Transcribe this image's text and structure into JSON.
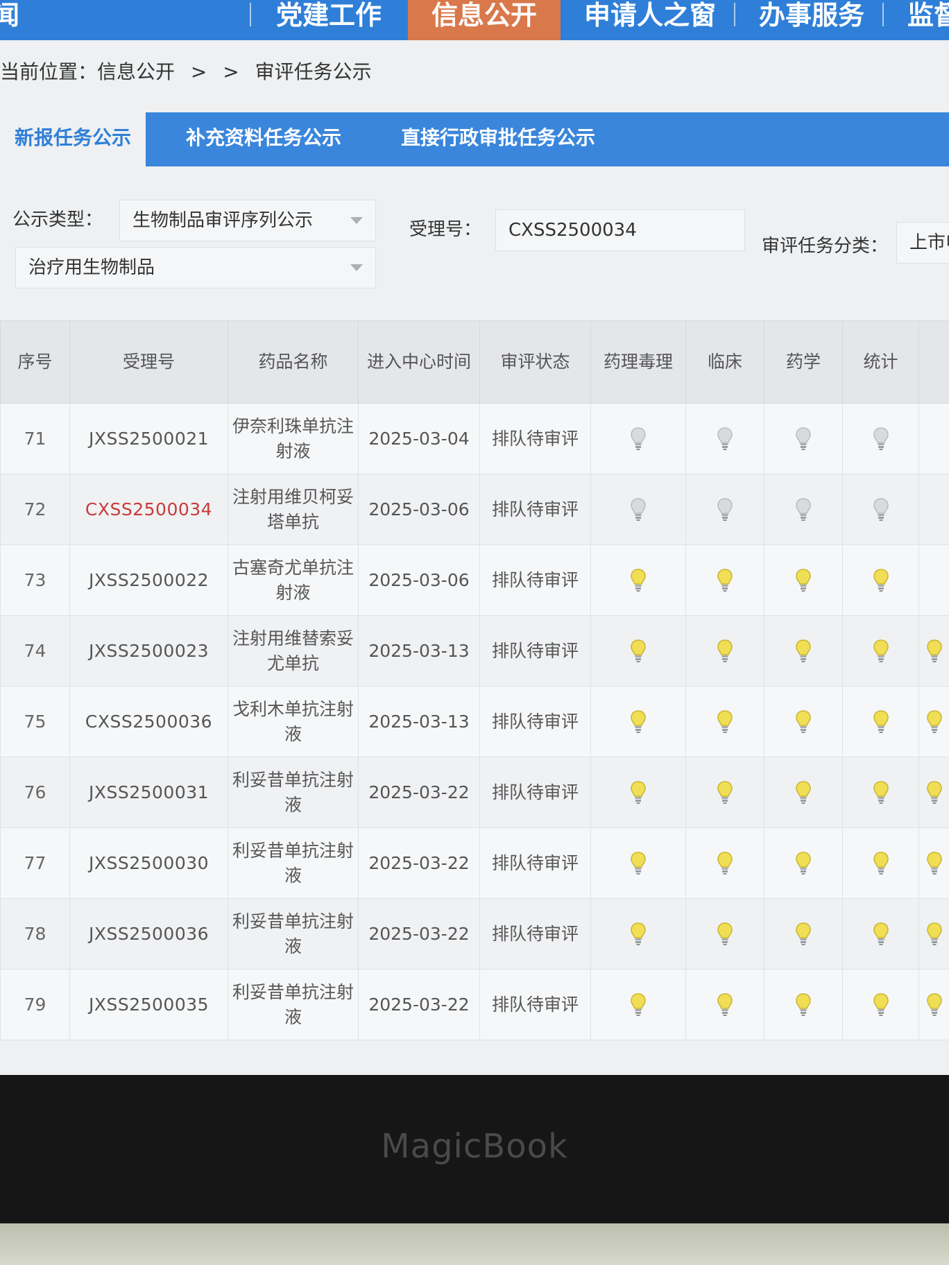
{
  "nav": {
    "item_1": "闻",
    "item_2": "党建工作",
    "item_3": "信息公开",
    "item_4": "申请人之窗",
    "item_5": "办事服务",
    "item_6": "监督"
  },
  "breadcrumb": {
    "label": "当前位置：信息公开",
    "sep1": ">",
    "sep2": ">",
    "current": "审评任务公示"
  },
  "tabs": [
    {
      "label": "新报任务公示",
      "active": true
    },
    {
      "label": "补充资料任务公示",
      "active": false
    },
    {
      "label": "直接行政审批任务公示",
      "active": false
    }
  ],
  "filters": {
    "type_label": "公示类型：",
    "type_value": "生物制品审评序列公示",
    "accept_label": "受理号：",
    "accept_value": "CXSS2500034",
    "task_label": "审评任务分类：",
    "task_value": "上市申",
    "category_value": "治疗用生物制品"
  },
  "table": {
    "headers": [
      "序号",
      "受理号",
      "药品名称",
      "进入中心时间",
      "审评状态",
      "药理毒理",
      "临床",
      "药学",
      "统计",
      ""
    ],
    "rows": [
      {
        "seq": "71",
        "accept_no": "JXSS2500021",
        "drug": "伊奈利珠单抗注射液",
        "date": "2025-03-04",
        "status": "排队待审评",
        "lit": false,
        "highlight": false
      },
      {
        "seq": "72",
        "accept_no": "CXSS2500034",
        "drug": "注射用维贝柯妥塔单抗",
        "date": "2025-03-06",
        "status": "排队待审评",
        "lit": false,
        "highlight": true
      },
      {
        "seq": "73",
        "accept_no": "JXSS2500022",
        "drug": "古塞奇尤单抗注射液",
        "date": "2025-03-06",
        "status": "排队待审评",
        "lit": true,
        "highlight": false
      },
      {
        "seq": "74",
        "accept_no": "JXSS2500023",
        "drug": "注射用维替索妥尤单抗",
        "date": "2025-03-13",
        "status": "排队待审评",
        "lit": true,
        "highlight": false
      },
      {
        "seq": "75",
        "accept_no": "CXSS2500036",
        "drug": "戈利木单抗注射液",
        "date": "2025-03-13",
        "status": "排队待审评",
        "lit": true,
        "highlight": false
      },
      {
        "seq": "76",
        "accept_no": "JXSS2500031",
        "drug": "利妥昔单抗注射液",
        "date": "2025-03-22",
        "status": "排队待审评",
        "lit": true,
        "highlight": false
      },
      {
        "seq": "77",
        "accept_no": "JXSS2500030",
        "drug": "利妥昔单抗注射液",
        "date": "2025-03-22",
        "status": "排队待审评",
        "lit": true,
        "highlight": false
      },
      {
        "seq": "78",
        "accept_no": "JXSS2500036",
        "drug": "利妥昔单抗注射液",
        "date": "2025-03-22",
        "status": "排队待审评",
        "lit": true,
        "highlight": false
      },
      {
        "seq": "79",
        "accept_no": "JXSS2500035",
        "drug": "利妥昔单抗注射液",
        "date": "2025-03-22",
        "status": "排队待审评",
        "lit": true,
        "highlight": false
      }
    ]
  },
  "icons": {
    "bulb_lit_color": "#f0df55",
    "bulb_unlit_color": "#d8dadc",
    "highlight_color": "#c83a3a"
  },
  "bezel": {
    "brand": "MagicBook"
  }
}
